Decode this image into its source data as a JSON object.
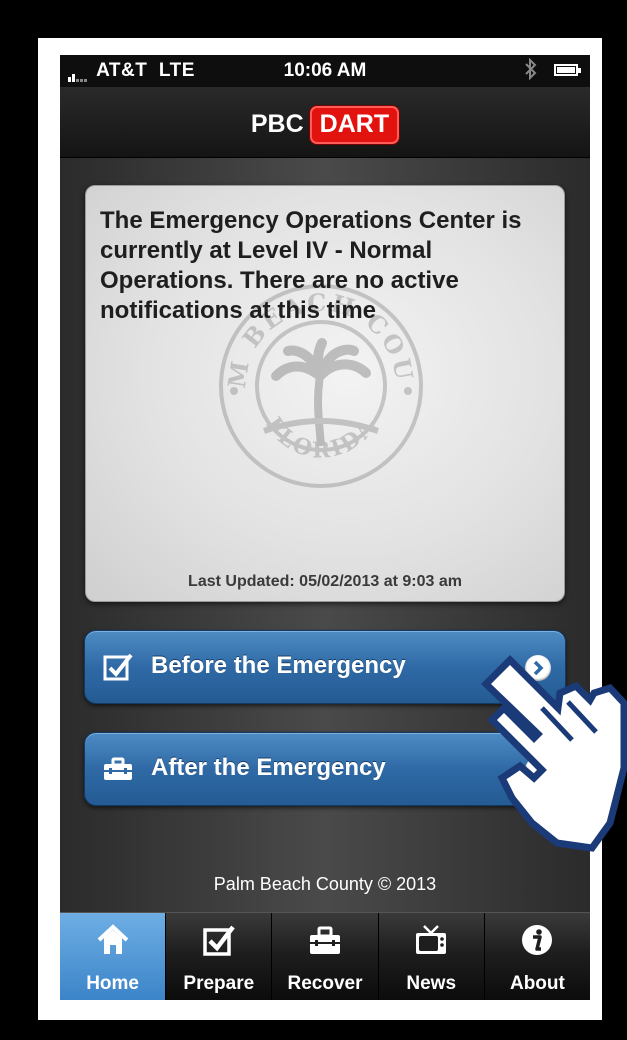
{
  "status_bar": {
    "carrier": "AT&T",
    "network": "LTE",
    "time": "10:06 AM",
    "bluetooth_icon": "bluetooth-icon",
    "battery_icon": "battery-icon"
  },
  "nav": {
    "title_prefix": "PBC",
    "title_badge": "DART",
    "badge_color": "#e2120f"
  },
  "notice": {
    "message": "The Emergency Operations Center is currently at Level IV - Normal Operations. There are no active notifications at this time",
    "last_updated": "Last Updated: 05/02/2013 at 9:03 am",
    "seal_top_text": "PALM BEACH COUNTY",
    "seal_bottom_text": "FLORIDA"
  },
  "buttons": {
    "before": {
      "label": "Before the Emergency",
      "icon": "checkbox-icon"
    },
    "after": {
      "label": "After the Emergency",
      "icon": "toolbox-icon"
    }
  },
  "footer": {
    "copyright": "Palm Beach County © 2013"
  },
  "tabs": [
    {
      "label": "Home",
      "icon": "home-icon",
      "active": true
    },
    {
      "label": "Prepare",
      "icon": "checkbox-icon",
      "active": false
    },
    {
      "label": "Recover",
      "icon": "toolbox-icon",
      "active": false
    },
    {
      "label": "News",
      "icon": "tv-icon",
      "active": false
    },
    {
      "label": "About",
      "icon": "info-icon",
      "active": false
    }
  ],
  "colors": {
    "accent_blue": "#2f6aa6",
    "active_tab": "#5aa0dc"
  }
}
